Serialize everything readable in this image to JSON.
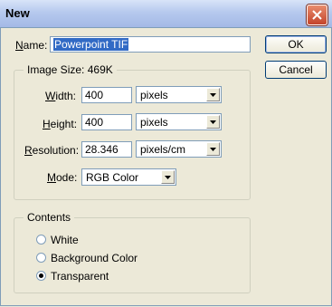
{
  "window": {
    "title": "New"
  },
  "name_field": {
    "label": "Name:",
    "value": "Powerpoint TIF"
  },
  "buttons": {
    "ok": "OK",
    "cancel": "Cancel"
  },
  "image_size": {
    "legend": "Image Size:",
    "size": "469K",
    "width": {
      "label": "Width:",
      "value": "400",
      "unit": "pixels"
    },
    "height": {
      "label": "Height:",
      "value": "400",
      "unit": "pixels"
    },
    "resolution": {
      "label": "Resolution:",
      "value": "28.346",
      "unit": "pixels/cm"
    },
    "mode": {
      "label": "Mode:",
      "value": "RGB Color"
    }
  },
  "contents": {
    "legend": "Contents",
    "options": [
      {
        "label": "White",
        "checked": false
      },
      {
        "label": "Background Color",
        "checked": false
      },
      {
        "label": "Transparent",
        "checked": true
      }
    ]
  },
  "icons": {
    "close": "close-icon",
    "dropdown": "chevron-down-icon",
    "radio": "radio-button"
  }
}
